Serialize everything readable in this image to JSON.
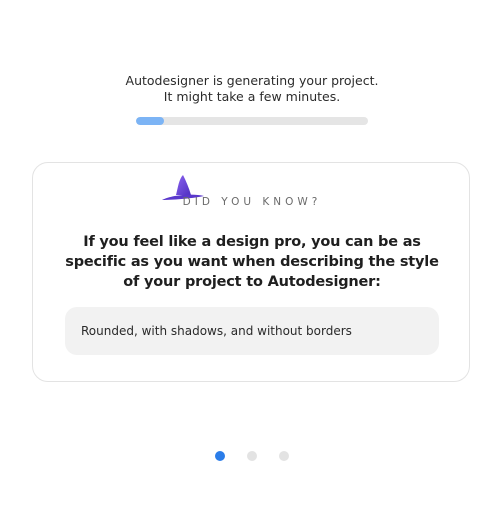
{
  "status": {
    "line1": "Autodesigner is generating your project.",
    "line2": "It might take a few minutes.",
    "progress_fraction": 0.12,
    "progress_color": "#7cb4f5"
  },
  "tip_card": {
    "icon": "wizard-hat-icon",
    "eyebrow": "DID YOU KNOW?",
    "text": "If you feel like a design pro, you can be as specific as you want when describing the style of your project to Autodesigner:",
    "example": "Rounded, with shadows, and without borders"
  },
  "carousel": {
    "count": 3,
    "active_index": 0,
    "active_color": "#2b7de9"
  }
}
